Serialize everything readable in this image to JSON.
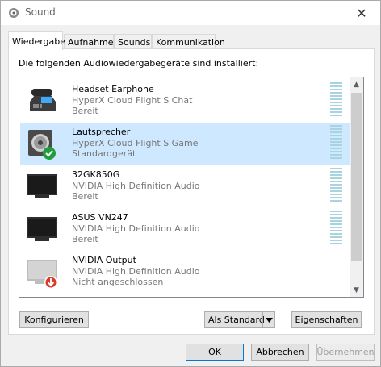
{
  "window": {
    "title": "Sound",
    "close_glyph": "✕"
  },
  "tabs": [
    {
      "label": "Wiedergabe",
      "active": true
    },
    {
      "label": "Aufnahme",
      "active": false
    },
    {
      "label": "Sounds",
      "active": false
    },
    {
      "label": "Kommunikation",
      "active": false
    }
  ],
  "panel": {
    "intro": "Die folgenden Audiowiedergabegeräte sind installiert:"
  },
  "devices": [
    {
      "name": "Headset Earphone",
      "description": "HyperX Cloud Flight S Chat",
      "status": "Bereit",
      "icon": "headset-phone-icon",
      "selected": false
    },
    {
      "name": "Lautsprecher",
      "description": "HyperX Cloud Flight S Game",
      "status": "Standardgerät",
      "icon": "speaker-icon",
      "badge": "default-check-icon",
      "selected": true
    },
    {
      "name": "32GK850G",
      "description": "NVIDIA High Definition Audio",
      "status": "Bereit",
      "icon": "monitor-icon",
      "selected": false
    },
    {
      "name": "ASUS VN247",
      "description": "NVIDIA High Definition Audio",
      "status": "Bereit",
      "icon": "monitor-icon",
      "selected": false
    },
    {
      "name": "NVIDIA Output",
      "description": "NVIDIA High Definition Audio",
      "status": "Nicht angeschlossen",
      "icon": "monitor-disconnected-icon",
      "badge": "unplugged-arrow-icon",
      "selected": false
    }
  ],
  "scroll": {
    "up": "▲",
    "down": "▼"
  },
  "actions": {
    "configure": "Konfigurieren",
    "set_default": "Als Standard",
    "properties": "Eigenschaften"
  },
  "footer": {
    "ok": "OK",
    "cancel": "Abbrechen",
    "apply": "Übernehmen"
  },
  "colors": {
    "selection": "#cde8ff",
    "meter": "#a8d3df",
    "accent": "#0078d7",
    "check_badge": "#1f9e3b",
    "unplug_badge": "#d83b2b"
  }
}
